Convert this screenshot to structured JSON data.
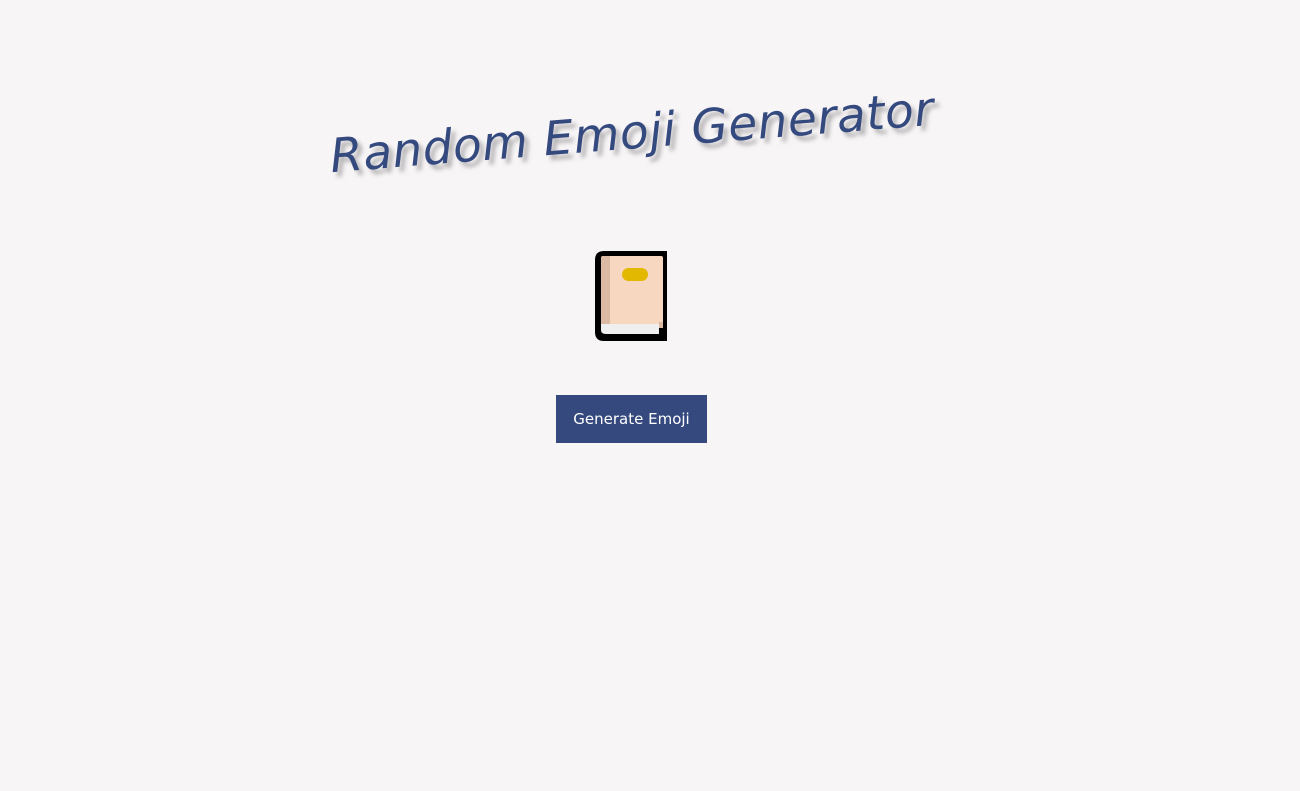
{
  "header": {
    "title": "Random Emoji Generator"
  },
  "emoji": {
    "icon": "closed-book-icon"
  },
  "actions": {
    "generate_label": "Generate Emoji"
  },
  "colors": {
    "background": "#f8f5f7",
    "accent": "#35497f",
    "title": "#34497e"
  }
}
